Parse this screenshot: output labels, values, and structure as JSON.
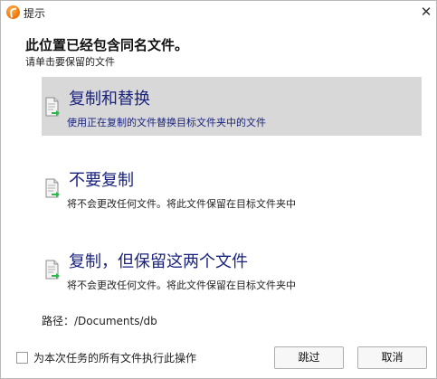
{
  "window": {
    "title": "提示",
    "close_glyph": "✕"
  },
  "message": {
    "heading": "此位置已经包含同名文件。",
    "instruction": "请单击要保留的文件"
  },
  "options": [
    {
      "title": "复制和替换",
      "description": "使用正在复制的文件替换目标文件夹中的文件",
      "selected": true,
      "icon": "document-arrow-icon"
    },
    {
      "title": "不要复制",
      "description": "将不会更改任何文件。将此文件保留在目标文件夹中",
      "selected": false,
      "icon": "document-arrow-icon"
    },
    {
      "title": "复制，但保留这两个文件",
      "description": "将不会更改任何文件。将此文件保留在目标文件夹中",
      "selected": false,
      "icon": "document-arrow-icon"
    }
  ],
  "path": {
    "label": "路径：/Documents/db"
  },
  "footer": {
    "apply_all_label": "为本次任务的所有文件执行此操作",
    "apply_all_checked": false,
    "skip_label": "跳过",
    "cancel_label": "取消"
  },
  "colors": {
    "option_title": "#1a237e",
    "selected_bg": "#d8d8d8",
    "arrow_green": "#2db84d",
    "app_icon_orange": "#f07a12"
  }
}
